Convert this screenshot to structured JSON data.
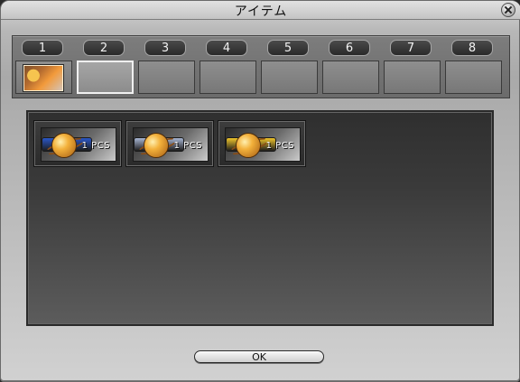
{
  "window": {
    "title": "アイテム"
  },
  "tabs": [
    {
      "number": "1"
    },
    {
      "number": "2"
    },
    {
      "number": "3"
    },
    {
      "number": "4"
    },
    {
      "number": "5"
    },
    {
      "number": "6"
    },
    {
      "number": "7"
    },
    {
      "number": "8"
    }
  ],
  "tab_slots": {
    "active_index": 1,
    "first_has_icon": true
  },
  "items": [
    {
      "count": "1 PCS",
      "stripe_color": "#2a57c8",
      "icon": "ringed-planet-icon"
    },
    {
      "count": "1 PCS",
      "stripe_color": "#a8b6d4",
      "icon": "ringed-planet-icon"
    },
    {
      "count": "1 PCS",
      "stripe_color": "#f0c52a",
      "icon": "ringed-planet-icon"
    }
  ],
  "buttons": {
    "ok": "OK"
  }
}
